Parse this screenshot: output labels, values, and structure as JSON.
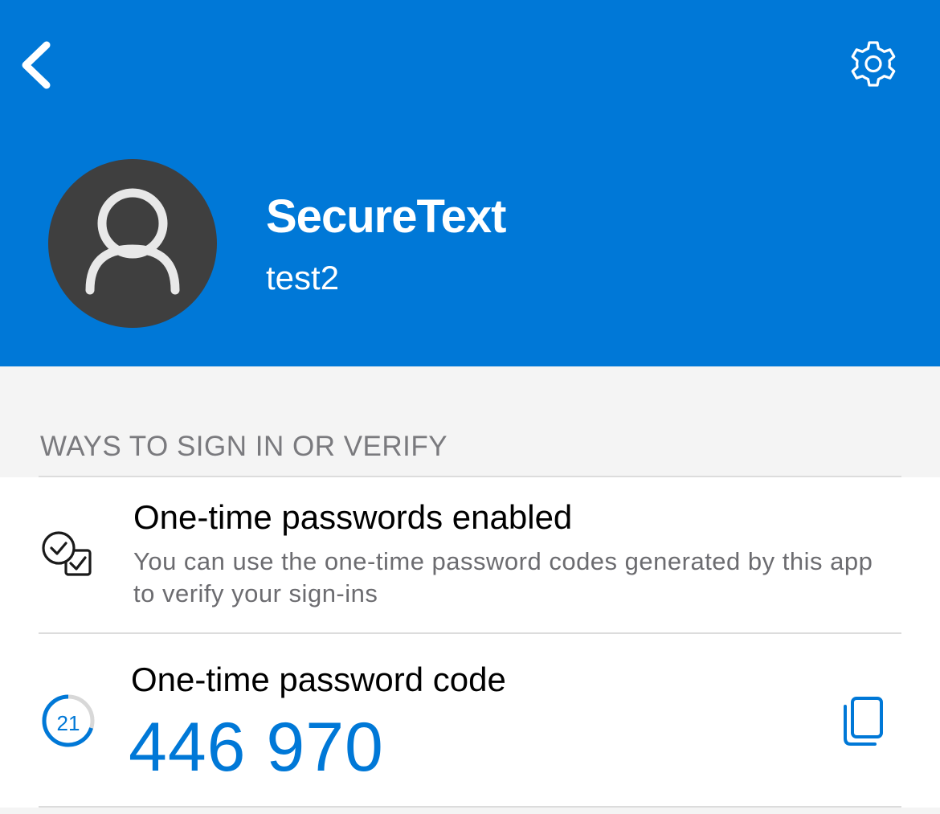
{
  "header": {
    "back_icon": "chevron-left-icon",
    "settings_icon": "gear-icon",
    "account_name": "SecureText",
    "account_user": "test2",
    "background": "#0078d7",
    "avatar_icon": "person-icon"
  },
  "section": {
    "title": "WAYS TO SIGN IN OR VERIFY"
  },
  "otp_enabled": {
    "icon": "checklist-icon",
    "title": "One-time passwords enabled",
    "description": "You can use the one-time password codes generated by this app to verify your sign-ins"
  },
  "otp_code": {
    "title": "One-time password code",
    "code": "446 970",
    "timer_seconds": "21",
    "timer_fraction_remaining": 0.7,
    "copy_icon": "copy-icon",
    "accent": "#0078d7"
  }
}
